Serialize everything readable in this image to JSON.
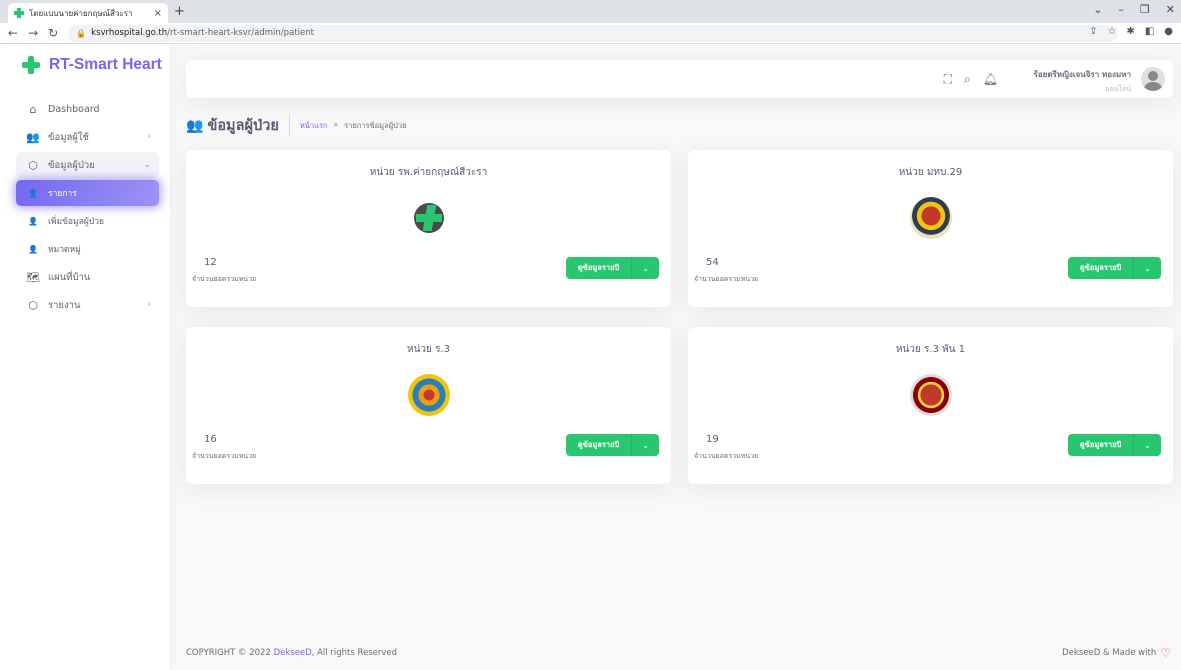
{
  "browser": {
    "tab_title": "โดยแบบนายค่ายกฤษณ์สีวะรา",
    "tab_close": "×",
    "new_tab": "+",
    "url_host": "ksvrhospital.go.th",
    "url_path": "/rt-smart-heart-ksvr/admin/patient"
  },
  "sidebar": {
    "brand": "RT-Smart Heart",
    "items": [
      {
        "label": "Dashboard",
        "icon": "home-icon"
      },
      {
        "label": "ข้อมูลผู้ใช้",
        "icon": "users-icon"
      },
      {
        "label": "ข้อมูลผู้ป่วย",
        "icon": "box-icon"
      },
      {
        "label": "รายการ",
        "icon": "user-icon"
      },
      {
        "label": "เพิ่มข้อมูลผู้ป่วย",
        "icon": "user-icon"
      },
      {
        "label": "หมวดหมู่",
        "icon": "user-icon"
      },
      {
        "label": "แผนที่บ้าน",
        "icon": "map-icon"
      },
      {
        "label": "รายงาน",
        "icon": "box-icon"
      }
    ]
  },
  "topbar": {
    "user_name": "ร้อยตรีหญิงเจนจิรา ทองมหา",
    "user_status": "ออนไลน์"
  },
  "page": {
    "title": "ข้อมูลผู้ป่วย",
    "breadcrumb_home": "หน้าแรก",
    "breadcrumb_sep": "»",
    "breadcrumb_current": "รายการข้อมูลผู้ป่วย"
  },
  "units": [
    {
      "name": "หน่วย รพ.ค่ายกฤษณ์สีวะรา",
      "count": "12",
      "count_label": "จำนวนยอดรวมหน่วย",
      "button": "ดูข้อมูลรายปี",
      "emblem": "hospital-cross-emblem"
    },
    {
      "name": "หน่วย มทบ.29",
      "count": "54",
      "count_label": "จำนวนยอดรวมหน่วย",
      "button": "ดูข้อมูลรายปี",
      "emblem": "military-badge-emblem"
    },
    {
      "name": "หน่วย ร.3",
      "count": "16",
      "count_label": "จำนวนยอดรวมหน่วย",
      "button": "ดูข้อมูลรายปี",
      "emblem": "regiment-star-emblem"
    },
    {
      "name": "หน่วย ร.3 พัน 1",
      "count": "19",
      "count_label": "จำนวนยอดรวมหน่วย",
      "button": "ดูข้อมูลรายปี",
      "emblem": "battalion-shield-emblem"
    }
  ],
  "footer": {
    "copyright_prefix": "COPYRIGHT © 2022 ",
    "copyright_brand": "DekseeD",
    "copyright_suffix": ", All rights Reserved",
    "made_with": "DekseeD & Made with"
  },
  "colors": {
    "primary": "#7367f0",
    "success": "#28c76f"
  }
}
